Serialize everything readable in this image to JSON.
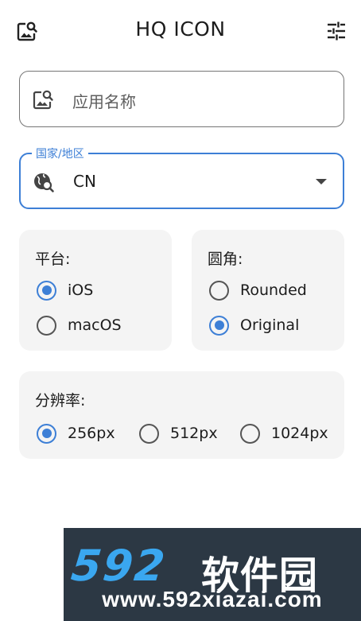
{
  "header": {
    "title": "HQ ICON",
    "left_icon": "image-search-icon",
    "right_icon": "tune-icon"
  },
  "app_name_field": {
    "placeholder": "应用名称",
    "icon": "image-search-icon"
  },
  "region_field": {
    "label": "国家/地区",
    "value": "CN",
    "icon": "globe-search-icon"
  },
  "platform": {
    "title": "平台:",
    "options": [
      {
        "label": "iOS",
        "selected": true
      },
      {
        "label": "macOS",
        "selected": false
      }
    ]
  },
  "corner": {
    "title": "圆角:",
    "options": [
      {
        "label": "Rounded",
        "selected": false
      },
      {
        "label": "Original",
        "selected": true
      }
    ]
  },
  "resolution": {
    "title": "分辨率:",
    "options": [
      {
        "label": "256px",
        "selected": true
      },
      {
        "label": "512px",
        "selected": false
      },
      {
        "label": "1024px",
        "selected": false
      }
    ]
  },
  "watermark": {
    "brand_digits": "592",
    "brand_text": "软件园",
    "url": "www.592xiazai.com"
  },
  "colors": {
    "accent": "#3d7fd6",
    "card_bg": "#f4f4f4",
    "watermark_bg": "#2c3844"
  }
}
